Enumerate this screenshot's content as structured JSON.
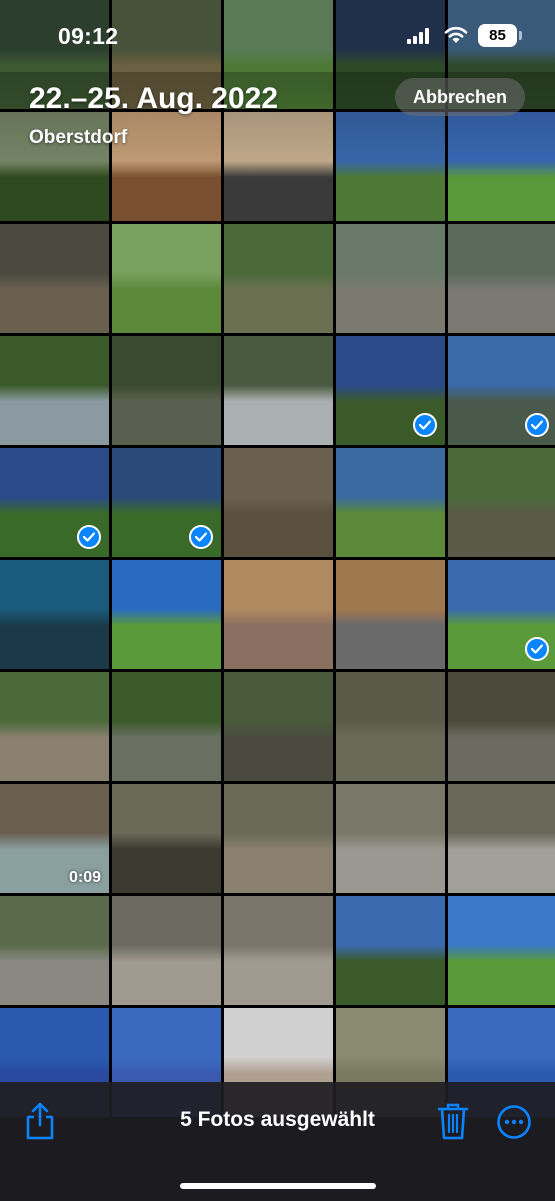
{
  "status_bar": {
    "time": "09:12",
    "battery": "85"
  },
  "header": {
    "title": "22.–25. Aug. 2022",
    "subtitle": "Oberstdorf",
    "cancel_label": "Abbrechen"
  },
  "grid": {
    "photos": [
      {
        "sky": "#2c3e2d",
        "ground": "#3d5a33",
        "selected": false
      },
      {
        "sky": "#46523a",
        "ground": "#6b6040",
        "selected": false
      },
      {
        "sky": "#5a7a56",
        "ground": "#4c7a36",
        "selected": false
      },
      {
        "sky": "#20304a",
        "ground": "#2d4a26",
        "selected": false
      },
      {
        "sky": "#3a5a7a",
        "ground": "#2f4a2a",
        "selected": false
      },
      {
        "sky": "#7a8a6a",
        "ground": "#2f4a1e",
        "selected": false
      },
      {
        "sky": "#c8a27a",
        "ground": "#7a5030",
        "selected": false
      },
      {
        "sky": "#c8b090",
        "ground": "#3a3a3a",
        "selected": false
      },
      {
        "sky": "#3a6ab0",
        "ground": "#4c7a36",
        "selected": false
      },
      {
        "sky": "#3a6ab8",
        "ground": "#5a9a3a",
        "selected": false
      },
      {
        "sky": "#4a4a40",
        "ground": "#6a6050",
        "selected": false
      },
      {
        "sky": "#7aa060",
        "ground": "#5a8a3a",
        "selected": false
      },
      {
        "sky": "#4a6a3a",
        "ground": "#6a7050",
        "selected": false
      },
      {
        "sky": "#6a7a6a",
        "ground": "#7a7a70",
        "selected": false
      },
      {
        "sky": "#5a6a5a",
        "ground": "#7a7870",
        "selected": false
      },
      {
        "sky": "#3a5a2a",
        "ground": "#8a9aa0",
        "selected": false
      },
      {
        "sky": "#3a4a30",
        "ground": "#5a6050",
        "selected": false
      },
      {
        "sky": "#4a5a40",
        "ground": "#aab0b0",
        "selected": false
      },
      {
        "sky": "#2a4a8a",
        "ground": "#3a5a2a",
        "selected": true
      },
      {
        "sky": "#3a6aa8",
        "ground": "#4a5a4a",
        "selected": true
      },
      {
        "sky": "#2a4a8a",
        "ground": "#3a6a2a",
        "selected": true
      },
      {
        "sky": "#2a4a7a",
        "ground": "#3a6a2a",
        "selected": true
      },
      {
        "sky": "#6a6050",
        "ground": "#5a5040",
        "selected": false
      },
      {
        "sky": "#3a6aa0",
        "ground": "#5a8a3a",
        "selected": false
      },
      {
        "sky": "#4a6a3a",
        "ground": "#5a5a48",
        "selected": false
      },
      {
        "sky": "#1a5a7a",
        "ground": "#1a3a4a",
        "selected": false
      },
      {
        "sky": "#2a6ac0",
        "ground": "#5a9a3a",
        "selected": false
      },
      {
        "sky": "#b08a60",
        "ground": "#8a7060",
        "selected": false
      },
      {
        "sky": "#a07850",
        "ground": "#6a6a6a",
        "selected": false
      },
      {
        "sky": "#3a6ab0",
        "ground": "#5a9a3a",
        "selected": true
      },
      {
        "sky": "#4a6a3a",
        "ground": "#8a8070",
        "selected": false
      },
      {
        "sky": "#3a5a2a",
        "ground": "#6a7060",
        "selected": false
      },
      {
        "sky": "#4a5a3a",
        "ground": "#4a4a40",
        "selected": false
      },
      {
        "sky": "#5a5a48",
        "ground": "#6a6a58",
        "selected": false
      },
      {
        "sky": "#4a4a3a",
        "ground": "#6a6a60",
        "selected": false
      },
      {
        "sky": "#6a6050",
        "ground": "#8aa0a0",
        "selected": false,
        "duration": "0:09"
      },
      {
        "sky": "#6a6a58",
        "ground": "#3a3a30",
        "selected": false
      },
      {
        "sky": "#6a6a58",
        "ground": "#8a8070",
        "selected": false
      },
      {
        "sky": "#7a7868",
        "ground": "#9a9890",
        "selected": false
      },
      {
        "sky": "#6a6858",
        "ground": "#a0a098",
        "selected": false
      },
      {
        "sky": "#5a6a4a",
        "ground": "#8a8880",
        "selected": false
      },
      {
        "sky": "#6a6a60",
        "ground": "#a09a90",
        "selected": false
      },
      {
        "sky": "#7a7568",
        "ground": "#a09a90",
        "selected": false
      },
      {
        "sky": "#3a6ab0",
        "ground": "#3a5a2a",
        "selected": false
      },
      {
        "sky": "#3a7ac8",
        "ground": "#5a9a3a",
        "selected": false
      },
      {
        "sky": "#2a5ab0",
        "ground": "#2a4aa0",
        "selected": false
      },
      {
        "sky": "#3a6ac0",
        "ground": "#3a5ab0",
        "selected": false
      },
      {
        "sky": "#d0d0d0",
        "ground": "#b0a090",
        "selected": false
      },
      {
        "sky": "#8a8a70",
        "ground": "#7a7a60",
        "selected": false
      },
      {
        "sky": "#3a6ac0",
        "ground": "#2a5ab0",
        "selected": false
      }
    ]
  },
  "toolbar": {
    "selection_label": "5 Fotos ausgewählt",
    "accent": "#0a84ff"
  }
}
